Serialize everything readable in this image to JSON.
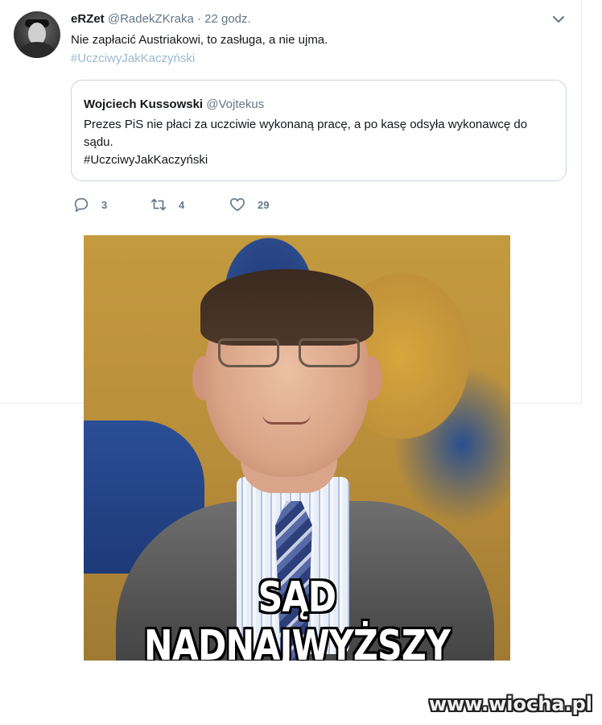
{
  "tweet": {
    "display_name": "eRZet",
    "handle": "@RadekZKraka",
    "separator": "·",
    "time": "22 godz.",
    "text": "Nie zapłacić Austriakowi, to zasługa, a nie ujma.",
    "hashtag": "#UczciwyJakKaczyński",
    "menu_icon": "chevron-down-icon"
  },
  "quoted": {
    "display_name": "Wojciech Kussowski",
    "handle": "@Vojtekus",
    "text": "Prezes PiS nie płaci za uczciwie wykonaną pracę, a po kasę odsyła wykonawcę do sądu.",
    "hashtag": "#UczciwyJakKaczyński"
  },
  "actions": {
    "reply": {
      "icon": "reply-icon",
      "count": "3"
    },
    "retweet": {
      "icon": "retweet-icon",
      "count": "4"
    },
    "like": {
      "icon": "heart-icon",
      "count": "29"
    }
  },
  "meme": {
    "caption": "SĄD NADNAJWYŻSZY"
  },
  "watermark": "www.wiocha.pl",
  "colors": {
    "text_primary": "#14171a",
    "text_secondary": "#657786",
    "hashtag_light": "#9bb7cf",
    "border": "#ccd6dd"
  }
}
